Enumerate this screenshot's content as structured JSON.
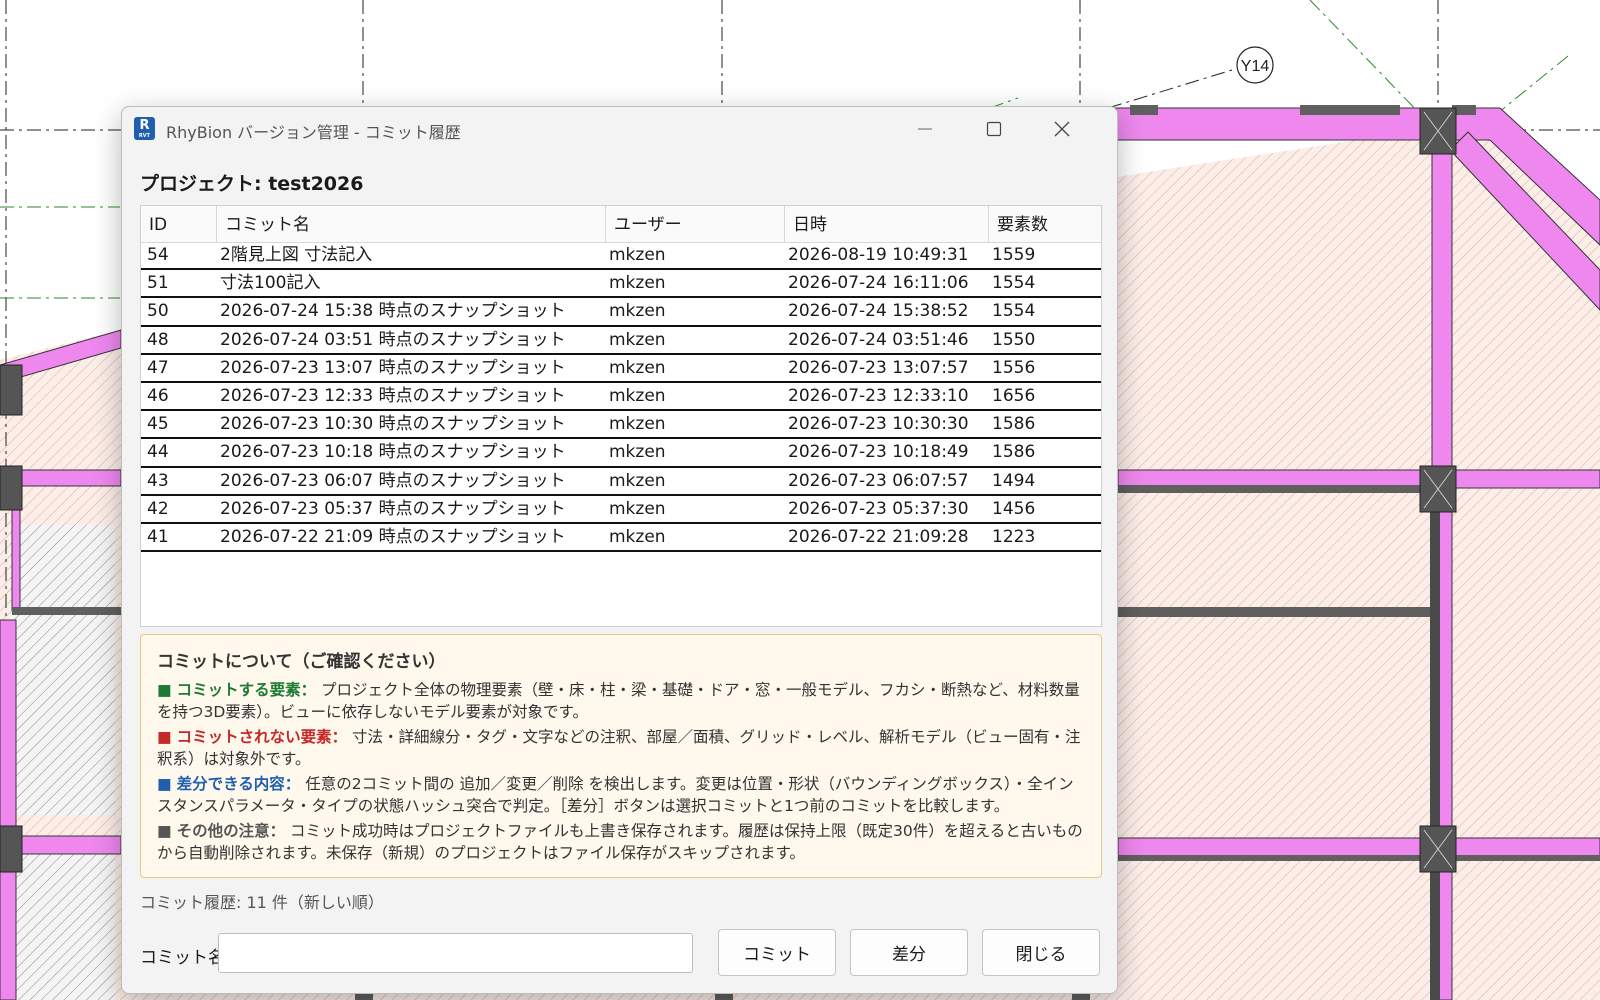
{
  "background": {
    "grid_label": "Y14",
    "colors": {
      "wall_pink": "#ee88ee",
      "wall_gray": "#5a5a5a",
      "hatch_fill": "#fbeee9",
      "hatch_line": "#e3a99a"
    }
  },
  "window": {
    "title": "RhyBion バージョン管理 - コミット履歴",
    "icon_letter": "R",
    "icon_sub": "RVT",
    "icon_color": "#1f5fae"
  },
  "project": {
    "label": "プロジェクト: test2026"
  },
  "table": {
    "columns": [
      "ID",
      "コミット名",
      "ユーザー",
      "日時",
      "要素数"
    ],
    "rows": [
      {
        "id": "54",
        "name": "2階見上図 寸法記入",
        "user": "mkzen",
        "datetime": "2026-08-19 10:49:31",
        "count": "1559"
      },
      {
        "id": "51",
        "name": "寸法100記入",
        "user": "mkzen",
        "datetime": "2026-07-24 16:11:06",
        "count": "1554"
      },
      {
        "id": "50",
        "name": "2026-07-24 15:38 時点のスナップショット",
        "user": "mkzen",
        "datetime": "2026-07-24 15:38:52",
        "count": "1554"
      },
      {
        "id": "48",
        "name": "2026-07-24 03:51 時点のスナップショット",
        "user": "mkzen",
        "datetime": "2026-07-24 03:51:46",
        "count": "1550"
      },
      {
        "id": "47",
        "name": "2026-07-23 13:07 時点のスナップショット",
        "user": "mkzen",
        "datetime": "2026-07-23 13:07:57",
        "count": "1556"
      },
      {
        "id": "46",
        "name": "2026-07-23 12:33 時点のスナップショット",
        "user": "mkzen",
        "datetime": "2026-07-23 12:33:10",
        "count": "1656"
      },
      {
        "id": "45",
        "name": "2026-07-23 10:30 時点のスナップショット",
        "user": "mkzen",
        "datetime": "2026-07-23 10:30:30",
        "count": "1586"
      },
      {
        "id": "44",
        "name": "2026-07-23 10:18 時点のスナップショット",
        "user": "mkzen",
        "datetime": "2026-07-23 10:18:49",
        "count": "1586"
      },
      {
        "id": "43",
        "name": "2026-07-23 06:07 時点のスナップショット",
        "user": "mkzen",
        "datetime": "2026-07-23 06:07:57",
        "count": "1494"
      },
      {
        "id": "42",
        "name": "2026-07-23 05:37 時点のスナップショット",
        "user": "mkzen",
        "datetime": "2026-07-23 05:37:30",
        "count": "1456"
      },
      {
        "id": "41",
        "name": "2026-07-22 21:09 時点のスナップショット",
        "user": "mkzen",
        "datetime": "2026-07-22 21:09:28",
        "count": "1223"
      }
    ]
  },
  "info": {
    "title": "コミットについて（ご確認ください）",
    "items": [
      {
        "square": "■",
        "label": "コミットする要素：",
        "text": "プロジェクト全体の物理要素（壁・床・柱・梁・基礎・ドア・窓・一般モデル、フカシ・断熱など、材料数量を持つ3D要素）。ビューに依存しないモデル要素が対象です。",
        "color": "#1e7b34"
      },
      {
        "square": "■",
        "label": "コミットされない要素：",
        "text": "寸法・詳細線分・タグ・文字などの注釈、部屋／面積、グリッド・レベル、解析モデル（ビュー固有・注釈系）は対象外です。",
        "color": "#c62828"
      },
      {
        "square": "■",
        "label": "差分できる内容：",
        "text": "任意の2コミット間の 追加／変更／削除 を検出します。変更は位置・形状（バウンディングボックス）・全インスタンスパラメータ・タイプの状態ハッシュ突合で判定。［差分］ボタンは選択コミットと1つ前のコミットを比較します。",
        "color": "#1f5fae"
      },
      {
        "square": "■",
        "label": "その他の注意：",
        "text": "コミット成功時はプロジェクトファイルも上書き保存されます。履歴は保持上限（既定30件）を超えると古いものから自動削除されます。未保存（新規）のプロジェクトはファイル保存がスキップされます。",
        "color": "#555555"
      }
    ]
  },
  "footer": {
    "history_count": "コミット履歴: 11 件（新しい順）",
    "commit_name_label": "コミット名:",
    "commit_name_value": "",
    "buttons": {
      "commit": "コミット",
      "diff": "差分",
      "close": "閉じる"
    }
  }
}
